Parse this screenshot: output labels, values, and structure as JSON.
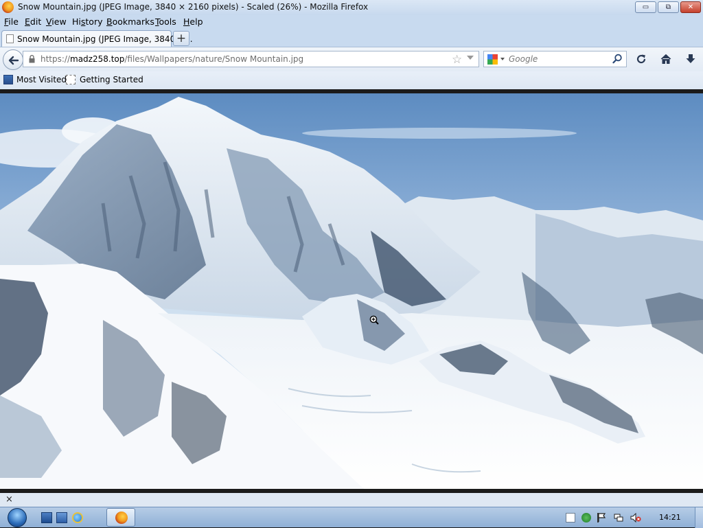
{
  "window": {
    "title": "Snow Mountain.jpg (JPEG Image, 3840 × 2160 pixels) - Scaled (26%) - Mozilla Firefox",
    "minimize_glyph": "▭",
    "maximize_glyph": "⧉",
    "close_glyph": "✕"
  },
  "menu": [
    {
      "label": "File",
      "accesskey": "F",
      "rest": "ile"
    },
    {
      "label": "Edit",
      "accesskey": "E",
      "rest": "dit"
    },
    {
      "label": "View",
      "accesskey": "V",
      "rest": "iew"
    },
    {
      "label": "History",
      "accesskey": "H",
      "rest": "istory",
      "pre": "Hi",
      "under": "s",
      "post": "tory"
    },
    {
      "label": "Bookmarks",
      "accesskey": "B",
      "rest": "ookmarks"
    },
    {
      "label": "Tools",
      "accesskey": "T",
      "rest": "ools"
    },
    {
      "label": "Help",
      "accesskey": "H",
      "rest": "elp"
    }
  ],
  "tabs": [
    {
      "label": "Snow Mountain.jpg (JPEG Image, 3840 ×..."
    }
  ],
  "new_tab_label": "+",
  "navbar": {
    "url_prefix": "https://",
    "url_host": "madz258.top",
    "url_path": "/files/Wallpapers/nature/Snow Mountain.jpg",
    "search_placeholder": "Google",
    "star_glyph": "☆"
  },
  "bookmarks": [
    {
      "label": "Most Visited"
    },
    {
      "label": "Getting Started"
    }
  ],
  "addon_bar": {
    "close_glyph": "×"
  },
  "taskbar": {
    "clock": "14:21"
  },
  "colors": {
    "chrome": "#c8daef",
    "taskbar": "#a7c2e2",
    "close_button": "#c5402c"
  },
  "image": {
    "name": "Snow Mountain.jpg",
    "scale_percent": 26,
    "natural_size": "3840 × 2160"
  }
}
